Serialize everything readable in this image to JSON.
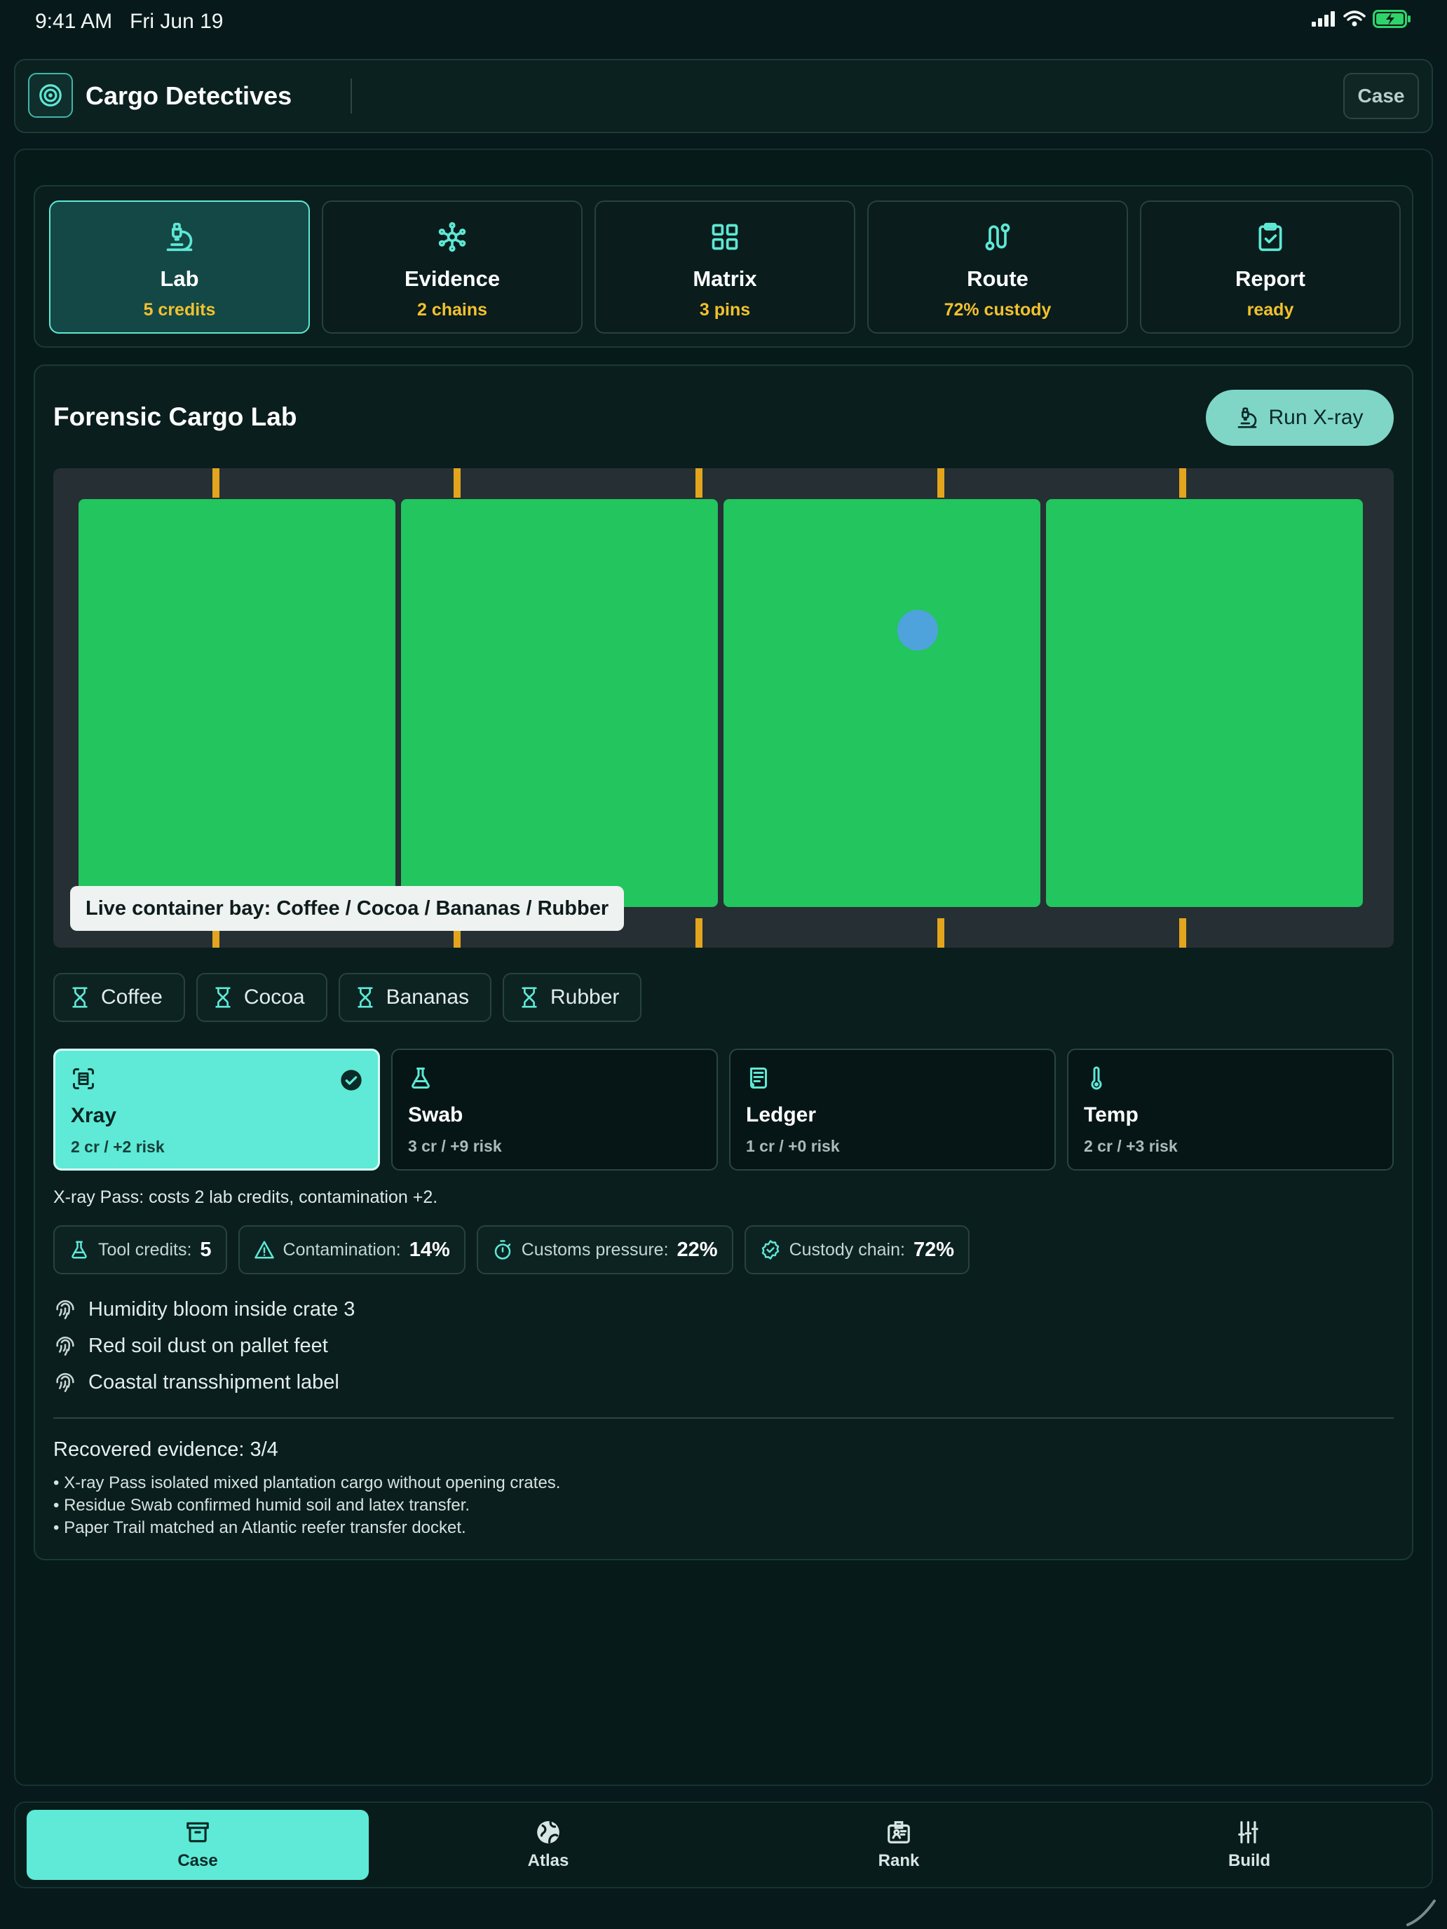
{
  "status": {
    "time": "9:41 AM",
    "date": "Fri Jun 19"
  },
  "header": {
    "title": "Cargo Detectives",
    "case_button": "Case"
  },
  "tabs": [
    {
      "name": "Lab",
      "sub": "5 credits",
      "icon": "microscope-icon"
    },
    {
      "name": "Evidence",
      "sub": "2 chains",
      "icon": "network-icon"
    },
    {
      "name": "Matrix",
      "sub": "3 pins",
      "icon": "grid-icon"
    },
    {
      "name": "Route",
      "sub": "72% custody",
      "icon": "route-icon"
    },
    {
      "name": "Report",
      "sub": "ready",
      "icon": "clipboard-check-icon"
    }
  ],
  "lab": {
    "title": "Forensic Cargo Lab",
    "run_button": "Run X-ray",
    "bay_label": "Live container bay: Coffee / Cocoa / Bananas / Rubber"
  },
  "cargo_chips": [
    "Coffee",
    "Cocoa",
    "Bananas",
    "Rubber"
  ],
  "tools": [
    {
      "name": "Xray",
      "cost": "2 cr / +2 risk",
      "icon": "scan-icon",
      "selected": true
    },
    {
      "name": "Swab",
      "cost": "3 cr / +9 risk",
      "icon": "flask-icon",
      "selected": false
    },
    {
      "name": "Ledger",
      "cost": "1 cr / +0 risk",
      "icon": "ledger-icon",
      "selected": false
    },
    {
      "name": "Temp",
      "cost": "2 cr / +3 risk",
      "icon": "thermometer-icon",
      "selected": false
    }
  ],
  "tool_description": "X-ray Pass: costs 2 lab credits, contamination +2.",
  "stats": [
    {
      "label": "Tool credits:",
      "value": "5"
    },
    {
      "label": "Contamination:",
      "value": "14%"
    },
    {
      "label": "Customs pressure:",
      "value": "22%"
    },
    {
      "label": "Custody chain:",
      "value": "72%"
    }
  ],
  "clues": [
    "Humidity bloom inside crate 3",
    "Red soil dust on pallet feet",
    "Coastal transshipment label"
  ],
  "recovered": {
    "title": "Recovered evidence: 3/4",
    "items": [
      "• X-ray Pass isolated mixed plantation cargo without opening crates.",
      "• Residue Swab confirmed humid soil and latex transfer.",
      "• Paper Trail matched an Atlantic reefer transfer docket."
    ]
  },
  "nav": [
    {
      "label": "Case",
      "icon": "archive-icon"
    },
    {
      "label": "Atlas",
      "icon": "globe-icon"
    },
    {
      "label": "Rank",
      "icon": "badge-icon"
    },
    {
      "label": "Build",
      "icon": "sliders-icon"
    }
  ],
  "colors": {
    "accent": "#5eead6",
    "container": "#22c55e",
    "rail": "#e3a51d",
    "highlight": "#f2c12e",
    "probe": "#4fa3dc"
  }
}
